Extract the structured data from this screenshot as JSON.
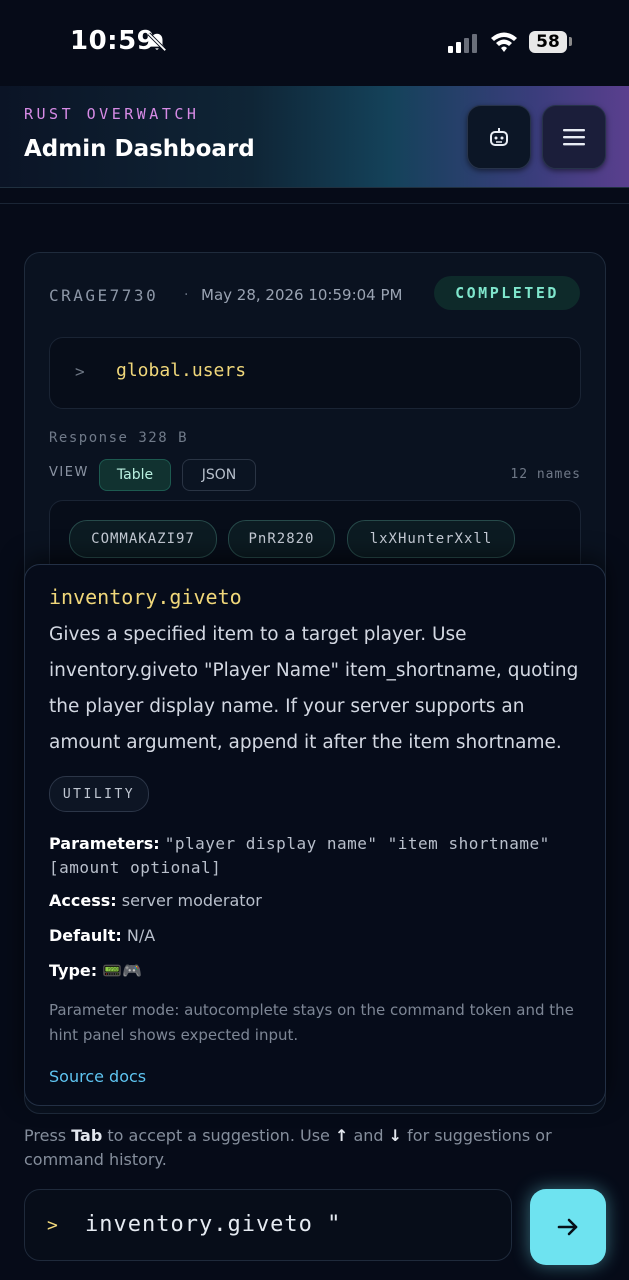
{
  "status_bar": {
    "time": "10:59",
    "battery": "58"
  },
  "header": {
    "eyebrow": "RUST OVERWATCH",
    "title": "Admin Dashboard"
  },
  "card": {
    "user": "CRAGE7730",
    "separator": "·",
    "timestamp": "May 28, 2026 10:59:04 PM",
    "status": "COMPLETED",
    "prompt": ">",
    "command": "global.users",
    "response": "Response 328 B",
    "view_label": "VIEW",
    "view_options": [
      "Table",
      "JSON"
    ],
    "count": "12 names",
    "names": [
      "COMMAKAZI97",
      "PnR2820",
      "lxXHunterXxll"
    ]
  },
  "popover": {
    "title": "inventory.giveto",
    "description": "Gives a specified item to a target player. Use inventory.giveto \"Player Name\" item_shortname, quoting the player display name. If your server supports an amount argument, append it after the item shortname.",
    "tag": "UTILITY",
    "parameters_label": "Parameters:",
    "parameters_value": "\"player display name\" \"item shortname\" [amount optional]",
    "access_label": "Access:",
    "access_value": "server moderator",
    "default_label": "Default:",
    "default_value": "N/A",
    "type_label": "Type:",
    "type_value": "📟🎮",
    "parameter_mode": "Parameter mode: autocomplete stays on the command token and the hint panel shows expected input.",
    "source_link": "Source docs"
  },
  "help": {
    "part1": "Press ",
    "key_tab": "Tab",
    "part2": " to accept a suggestion. Use ",
    "key_up": "↑",
    "part3": " and ",
    "key_down": "↓",
    "part4": " for suggestions or command history."
  },
  "input": {
    "prompt": ">",
    "value": "inventory.giveto \""
  },
  "colors": {
    "accent_cyan": "#6ee3f0",
    "command_yellow": "#f0d77a",
    "status_green": "#7fe6cc",
    "eyebrow_pink": "#d78be6"
  }
}
